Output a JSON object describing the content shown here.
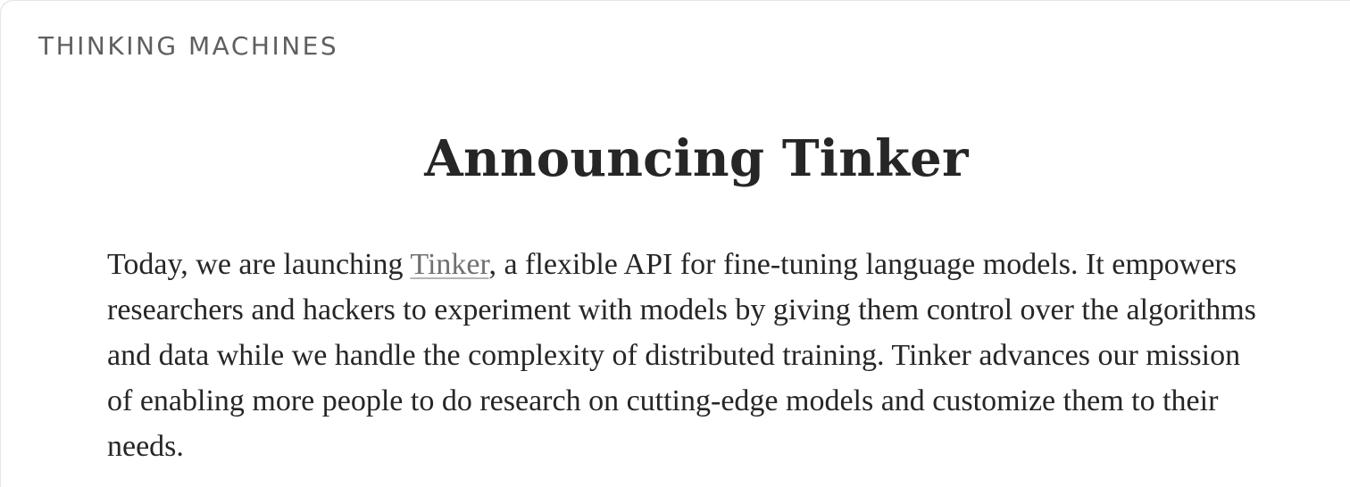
{
  "header": {
    "brand": "THINKING MACHINES"
  },
  "article": {
    "title": "Announcing Tinker",
    "intro": {
      "before_link": "Today, we are launching ",
      "link_text": "Tinker",
      "after_link": ", a flexible API for fine-tuning language models. It empowers researchers and hackers to experiment with models by giving them control over the algorithms and data while we handle the complexity of distributed training. Tinker advances our mission of enabling more people to do research on cutting-edge models and customize them to their needs."
    }
  },
  "colors": {
    "text": "#262626",
    "brand": "#5f5f5f",
    "link": "#707070",
    "background": "#ffffff"
  }
}
